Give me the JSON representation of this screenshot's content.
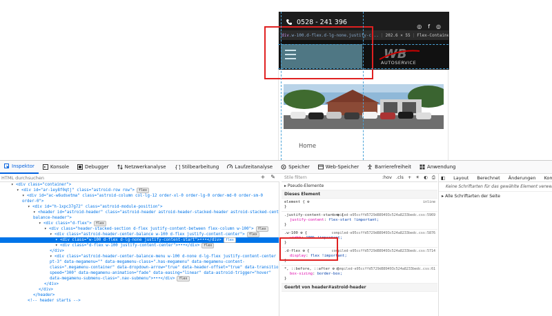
{
  "preview": {
    "phone": "0528 - 241 396",
    "social_icons": [
      "instagram-icon",
      "facebook-icon",
      "instagram-icon"
    ],
    "tooltip": {
      "tag": "div",
      "classes": ".w-100.d-flex.d-lg-none.justify-c...",
      "size": "202.6 × 55",
      "type": "Flex-Container/Element"
    },
    "logo_text": "AUTOSERVICE",
    "home_link": "Home"
  },
  "devtools": {
    "tabs": [
      {
        "label": "Inspektor",
        "icon": "inspector-icon",
        "active": true
      },
      {
        "label": "Konsole",
        "icon": "console-icon"
      },
      {
        "label": "Debugger",
        "icon": "debugger-icon"
      },
      {
        "label": "Netzwerkanalyse",
        "icon": "network-icon"
      },
      {
        "label": "Stilbearbeitung",
        "icon": "style-editor-icon"
      },
      {
        "label": "Laufzeitanalyse",
        "icon": "performance-icon"
      },
      {
        "label": "Speicher",
        "icon": "memory-icon"
      },
      {
        "label": "Web-Speicher",
        "icon": "storage-icon"
      },
      {
        "label": "Barrierefreiheit",
        "icon": "accessibility-icon"
      },
      {
        "label": "Anwendung",
        "icon": "application-icon"
      }
    ],
    "search_placeholder": "HTML durchsuchen",
    "markup_lines": [
      {
        "indent": 2,
        "html": "<div class=\"container\">"
      },
      {
        "indent": 3,
        "html": "<div id=\"ar-1ey8f0qtj\" class=\"astroid-row row\">",
        "badge": "flex"
      },
      {
        "indent": 4,
        "html": "<div id=\"ac-w6udsetma\" class=\"astroid-column col-lg-12 order-xl-0 order-lg-0 order-md-0 order-sm-0"
      },
      {
        "indent": 4,
        "html": "order-0\">"
      },
      {
        "indent": 5,
        "html": "<div id=\"h-1xpc37g72\" class=\"astroid-module-position\">"
      },
      {
        "indent": 6,
        "html": "<header id=\"astroid-header\" class=\"astroid-header astroid-header-stacked-header astroid-stacked-center-"
      },
      {
        "indent": 6,
        "html": "balance-header\">"
      },
      {
        "indent": 7,
        "html": "<div class=\"d-flex\">",
        "badge": "flex"
      },
      {
        "indent": 8,
        "html": "<div class=\"header-stacked-section d-flex justify-content-between flex-column w-100\">",
        "badge": "flex"
      },
      {
        "indent": 9,
        "html": "<div class=\"astroid-header-center-balance w-100 d-flex justify-content-center\">",
        "badge": "flex"
      },
      {
        "indent": 10,
        "html": "<div class=\"w-100 d-flex d-lg-none justify-content-start\">•••</div>",
        "badge": "flex",
        "selected": true
      },
      {
        "indent": 10,
        "html": "<div class=\"d-flex w-100 justify-content-center\">•••</div>",
        "badge": "flex"
      },
      {
        "indent": 9,
        "html": "</div>"
      },
      {
        "indent": 9,
        "html": "<div class=\"astroid-header-center-balance-menu w-100 d-none d-lg-flex justify-content-center"
      },
      {
        "indent": 9,
        "html": "pt-3\" data-megamenu=\"\" data-megamenu-class=\".has-megamenu\" data-megamenu-content-"
      },
      {
        "indent": 9,
        "html": "class=\".megamenu-container\" data-dropdown-arrow=\"true\" data-header-offset=\"true\" data-transition-"
      },
      {
        "indent": 9,
        "html": "speed=\"300\" data-megamenu-animation=\"fade\" data-easing=\"linear\" data-astroid-trigger=\"hover\""
      },
      {
        "indent": 9,
        "html": "data-megamenu-submenu-class=\".nav-submenu\">•••</div>",
        "badge": "flex"
      },
      {
        "indent": 8,
        "html": "</div>"
      },
      {
        "indent": 7,
        "html": "</div>"
      },
      {
        "indent": 6,
        "html": "</header>"
      },
      {
        "indent": 5,
        "html": "<!-- header starts -->"
      }
    ],
    "rules": {
      "filter_placeholder": "Stile filtern",
      "toolbar": [
        ":hov",
        ".cls",
        "+"
      ],
      "pseudo_label": "Pseudo-Elemente",
      "this_element_label": "Dieses Element",
      "element_rule": {
        "selector": "element {",
        "source": "inline"
      },
      "blocks": [
        {
          "selector": ".justify-content-start",
          "source": "compiled-e95ccffd5729d889493c524a8233bedc.css:5969",
          "prop": "justify-content",
          "value": "flex-start !important;"
        },
        {
          "selector": ".w-100",
          "source": "compiled-e95ccffd5729d889493c524a8233bedc.css:5876",
          "prop": "width",
          "value": "100% !important;"
        },
        {
          "selector": ".d-flex",
          "source": "compiled-e95ccffd5729d889493c524a8233bedc.css:5714",
          "prop": "display",
          "value": "flex !important;"
        },
        {
          "selector": "*, ::before, ::after",
          "source": "compiled-e95ccffd5729d889493c524a8233bedc.css:61",
          "prop": "box-sizing",
          "value": "border-box;"
        }
      ],
      "inherited_label": "Geerbt von header#astroid-header"
    },
    "layout": {
      "tabs": [
        "Layout",
        "Berechnet",
        "Änderungen",
        "Kompa"
      ],
      "message": "Keine Schriftarten für das gewählte Element verwend",
      "section": "Alle Schriftarten der Seite"
    }
  }
}
